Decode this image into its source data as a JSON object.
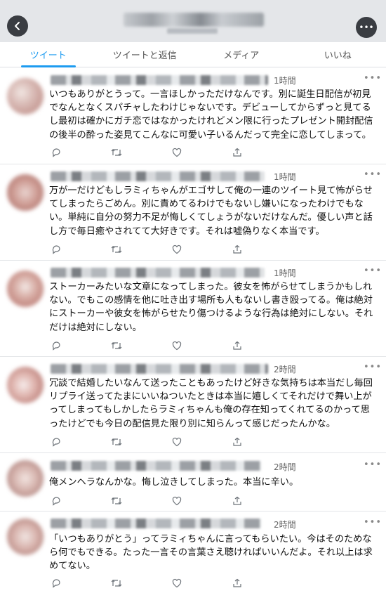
{
  "header": {
    "back_icon": "chevron-left-icon",
    "more_icon": "ellipsis-icon"
  },
  "tabs": [
    {
      "label": "ツイート",
      "active": true
    },
    {
      "label": "ツイートと返信",
      "active": false
    },
    {
      "label": "メディア",
      "active": false
    },
    {
      "label": "いいね",
      "active": false
    }
  ],
  "tweets": [
    {
      "time": "1時間",
      "text": "いつもありがとうって。一言ほしかっただけなんです。別に誕生日配信が初見でなんとなくスパチャしたわけじゃないです。デビューしてからずっと見てるし最初は確かにガチ恋ではなかったけれどメン限に行ったプレゼント開封配信の後半の酔った姿見てこんなに可愛い子いるんだって完全に恋してしまって。"
    },
    {
      "time": "1時間",
      "text": "万が一だけどもしラミィちゃんがエゴサして俺の一連のツイート見て怖がらせてしまったらごめん。別に責めてるわけでもないし嫌いになったわけでもない。単純に自分の努力不足が悔しくてしょうがないだけなんだ。優しい声と話し方で毎日癒やされてて大好きです。それは嘘偽りなく本当です。"
    },
    {
      "time": "1時間",
      "text": "ストーカーみたいな文章になってしまった。彼女を怖がらせてしまうかもしれない。でもこの感情を他に吐き出す場所も人もないし書き殴ってる。俺は絶対にストーカーや彼女を怖がらせたり傷つけるような行為は絶対にしない。それだけは絶対にしない。"
    },
    {
      "time": "2時間",
      "text": "冗談で結婚したいなんて送ったこともあったけど好きな気持ちは本当だし毎回リプライ送ってたまにいいねついたときは本当に嬉しくてそれだけで舞い上がってしまってもしかしたらラミィちゃんも俺の存在知ってくれてるのかって思ったけどでも今日の配信見た限り別に知らんって感じだったんかな。"
    },
    {
      "time": "2時間",
      "text": "俺メンヘラなんかな。悔し泣きしてしまった。本当に辛い。"
    },
    {
      "time": "2時間",
      "text": "「いつもありがとう」ってラミィちゃんに言ってもらいたい。今はそのためなら何でもできる。たった一言その言葉さえ聴ければいいんだよ。それ以上は求めてない。"
    }
  ],
  "actions": {
    "reply_icon": "reply-icon",
    "retweet_icon": "retweet-icon",
    "like_icon": "heart-icon",
    "share_icon": "share-icon",
    "more_dots": "•••"
  },
  "colors": {
    "accent": "#1d9bf0",
    "header_bg": "#e4e6e9",
    "button_bg": "#3a3d42"
  }
}
